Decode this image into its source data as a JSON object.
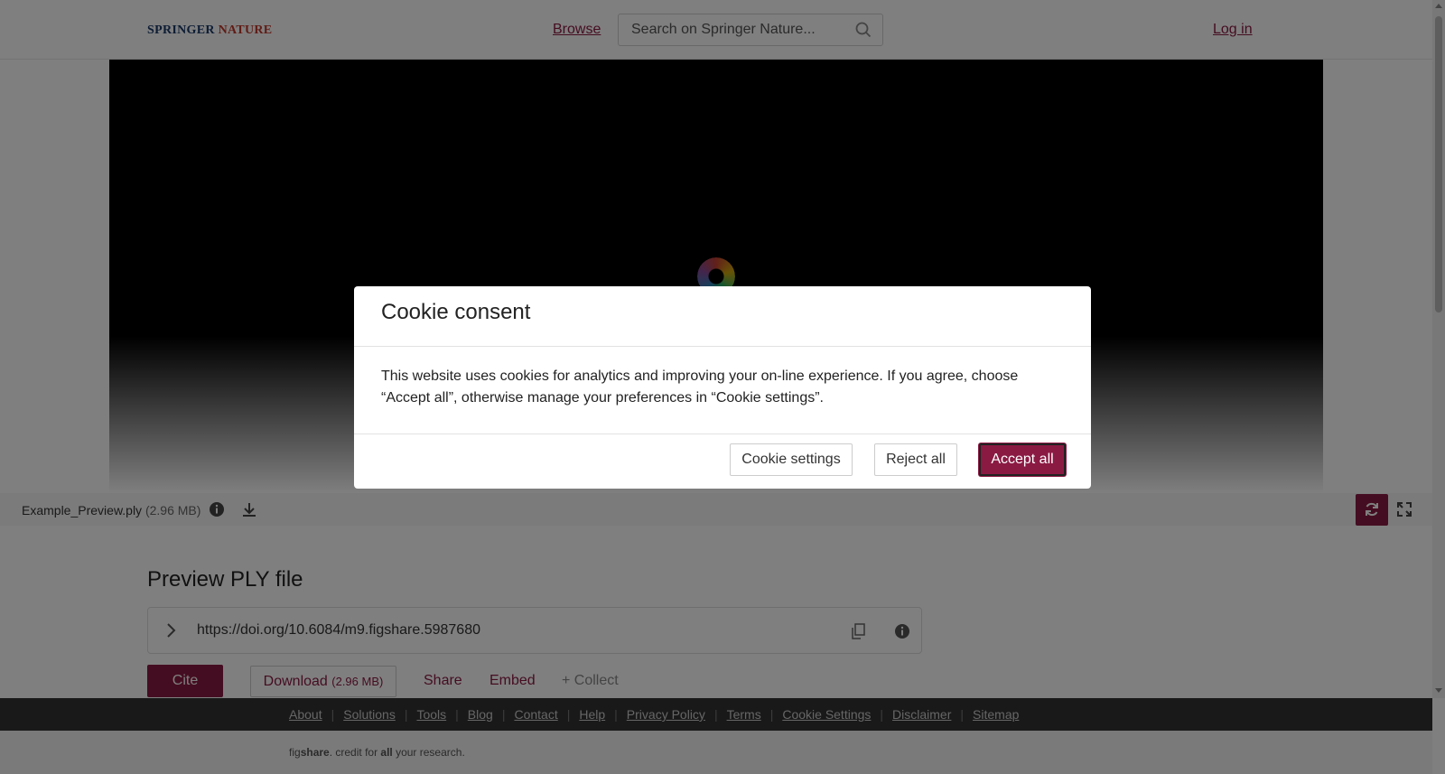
{
  "header": {
    "logo_part1": "SPRINGER",
    "logo_part2": "NATURE",
    "browse_label": "Browse",
    "search_placeholder": "Search on Springer Nature...",
    "login_label": "Log in"
  },
  "file": {
    "name": "Example_Preview.ply",
    "size": "(2.96 MB)"
  },
  "content": {
    "title": "Preview PLY file",
    "doi": "https://doi.org/10.6084/m9.figshare.5987680",
    "cite_label": "Cite",
    "download_label": "Download",
    "download_size": "(2.96 MB)",
    "share_label": "Share",
    "embed_label": "Embed",
    "collect_label": "+ Collect"
  },
  "footer": {
    "links": [
      "About",
      "Solutions",
      "Tools",
      "Blog",
      "Contact",
      "Help",
      "Privacy Policy",
      "Terms",
      "Cookie Settings",
      "Disclaimer",
      "Sitemap"
    ],
    "tagline_prefix": "fig",
    "tagline_brand": "share",
    "tagline_mid": ". credit for ",
    "tagline_bold": "all",
    "tagline_end": " your research."
  },
  "modal": {
    "title": "Cookie consent",
    "body": "This website uses cookies for analytics and improving your on-line experience. If you agree, choose “Accept all”, otherwise manage your preferences in “Cookie settings”.",
    "settings_label": "Cookie settings",
    "reject_label": "Reject all",
    "accept_label": "Accept all"
  },
  "colors": {
    "brand": "#8b1a43",
    "footer_bg": "#333333"
  },
  "icons": [
    "search-icon",
    "info-icon",
    "download-icon",
    "refresh-icon",
    "expand-icon",
    "chevron-right-icon",
    "copy-icon"
  ]
}
